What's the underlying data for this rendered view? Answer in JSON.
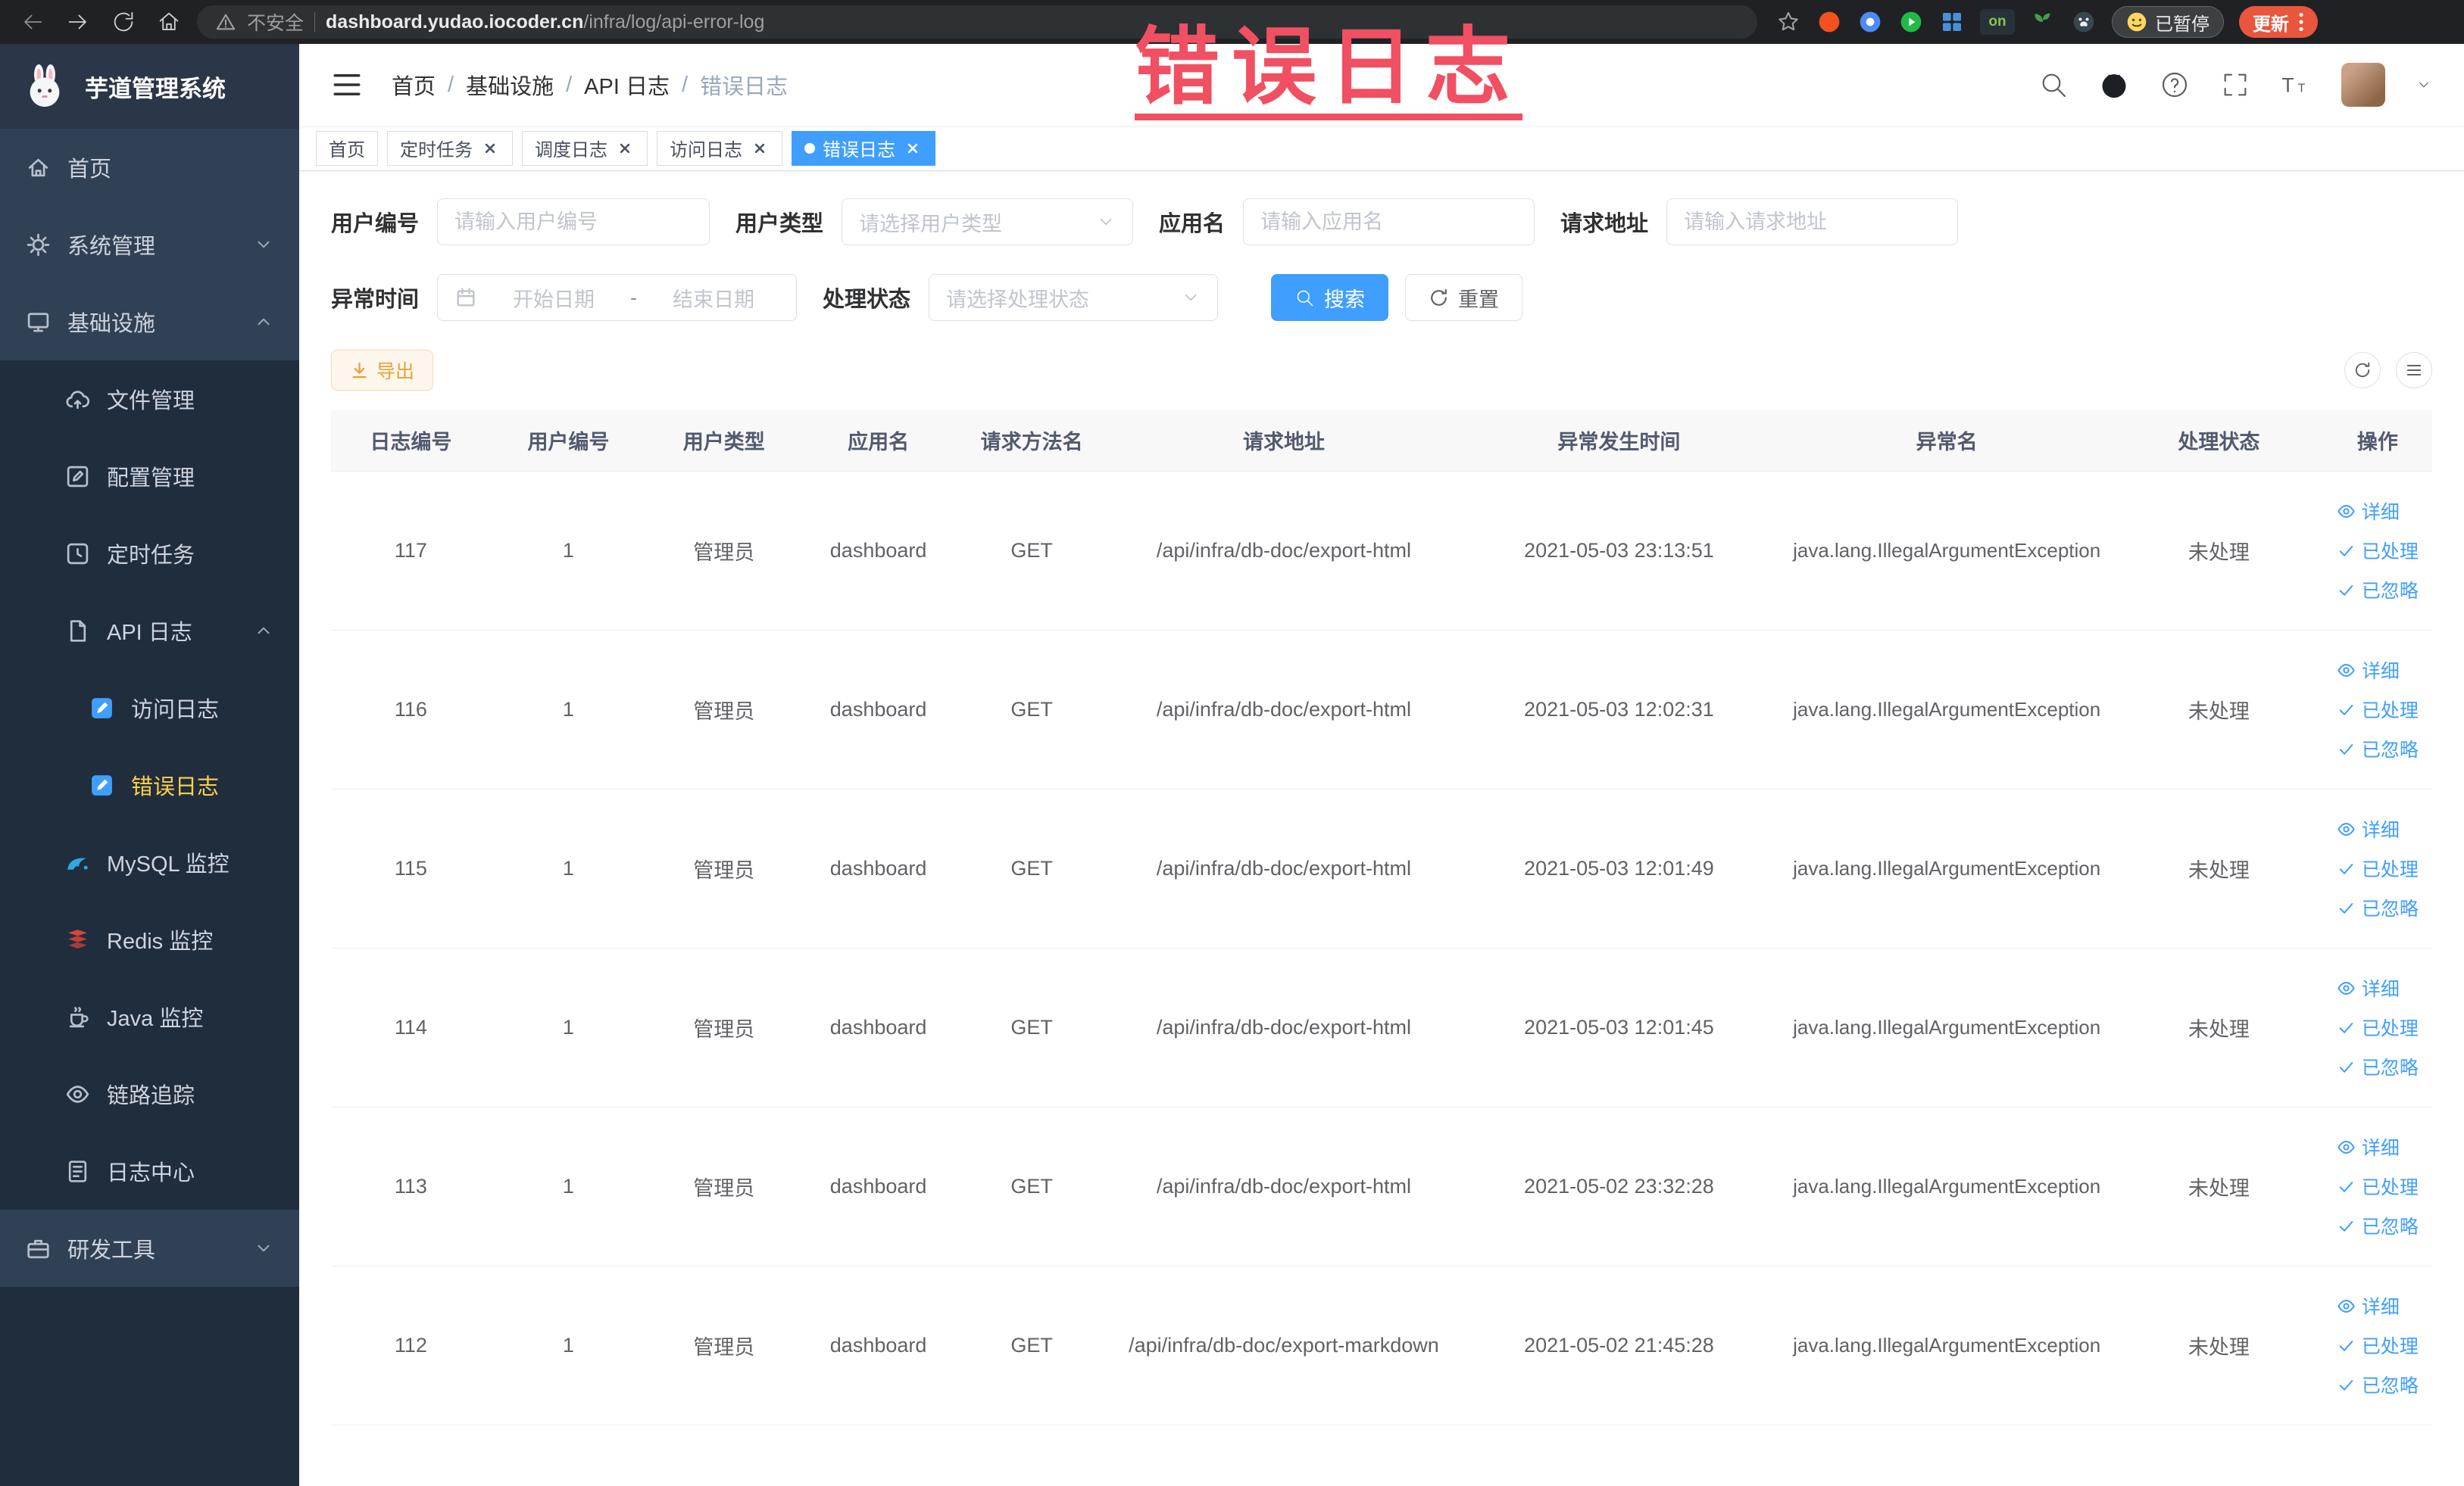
{
  "browser": {
    "security_label": "不安全",
    "url_domain": "dashboard.yudao.iocoder.cn",
    "url_path": "/infra/log/api-error-log",
    "extension_on_badge": "on",
    "paused_badge": "已暂停",
    "update_button": "更新"
  },
  "sidebar": {
    "app_title": "芋道管理系统",
    "items": [
      {
        "label": "首页"
      },
      {
        "label": "系统管理"
      },
      {
        "label": "基础设施"
      },
      {
        "label": "文件管理"
      },
      {
        "label": "配置管理"
      },
      {
        "label": "定时任务"
      },
      {
        "label": "API 日志"
      },
      {
        "label": "访问日志"
      },
      {
        "label": "错误日志"
      },
      {
        "label": "MySQL 监控"
      },
      {
        "label": "Redis 监控"
      },
      {
        "label": "Java 监控"
      },
      {
        "label": "链路追踪"
      },
      {
        "label": "日志中心"
      },
      {
        "label": "研发工具"
      }
    ]
  },
  "breadcrumb": {
    "separator": "/",
    "items": [
      "首页",
      "基础设施",
      "API 日志",
      "错误日志"
    ]
  },
  "tags": [
    {
      "label": "首页"
    },
    {
      "label": "定时任务"
    },
    {
      "label": "调度日志"
    },
    {
      "label": "访问日志"
    },
    {
      "label": "错误日志"
    }
  ],
  "filters": {
    "user_id": {
      "label": "用户编号",
      "placeholder": "请输入用户编号"
    },
    "user_type": {
      "label": "用户类型",
      "placeholder": "请选择用户类型"
    },
    "app_name": {
      "label": "应用名",
      "placeholder": "请输入应用名"
    },
    "request_url": {
      "label": "请求地址",
      "placeholder": "请输入请求地址"
    },
    "exception_time": {
      "label": "异常时间",
      "start_placeholder": "开始日期",
      "separator": "-",
      "end_placeholder": "结束日期"
    },
    "process_status": {
      "label": "处理状态",
      "placeholder": "请选择处理状态"
    },
    "search_button": "搜索",
    "reset_button": "重置"
  },
  "toolbar": {
    "export_button": "导出"
  },
  "table": {
    "columns": [
      "日志编号",
      "用户编号",
      "用户类型",
      "应用名",
      "请求方法名",
      "请求地址",
      "异常发生时间",
      "异常名",
      "处理状态",
      "操作"
    ],
    "actions": {
      "detail": "详细",
      "processed": "已处理",
      "ignored": "已忽略"
    },
    "rows": [
      {
        "id": "117",
        "user_id": "1",
        "user_type": "管理员",
        "app": "dashboard",
        "method": "GET",
        "url": "/api/infra/db-doc/export-html",
        "time": "2021-05-03 23:13:51",
        "exception": "java.lang.IllegalArgumentException",
        "status": "未处理"
      },
      {
        "id": "116",
        "user_id": "1",
        "user_type": "管理员",
        "app": "dashboard",
        "method": "GET",
        "url": "/api/infra/db-doc/export-html",
        "time": "2021-05-03 12:02:31",
        "exception": "java.lang.IllegalArgumentException",
        "status": "未处理"
      },
      {
        "id": "115",
        "user_id": "1",
        "user_type": "管理员",
        "app": "dashboard",
        "method": "GET",
        "url": "/api/infra/db-doc/export-html",
        "time": "2021-05-03 12:01:49",
        "exception": "java.lang.IllegalArgumentException",
        "status": "未处理"
      },
      {
        "id": "114",
        "user_id": "1",
        "user_type": "管理员",
        "app": "dashboard",
        "method": "GET",
        "url": "/api/infra/db-doc/export-html",
        "time": "2021-05-03 12:01:45",
        "exception": "java.lang.IllegalArgumentException",
        "status": "未处理"
      },
      {
        "id": "113",
        "user_id": "1",
        "user_type": "管理员",
        "app": "dashboard",
        "method": "GET",
        "url": "/api/infra/db-doc/export-html",
        "time": "2021-05-02 23:32:28",
        "exception": "java.lang.IllegalArgumentException",
        "status": "未处理"
      },
      {
        "id": "112",
        "user_id": "1",
        "user_type": "管理员",
        "app": "dashboard",
        "method": "GET",
        "url": "/api/infra/db-doc/export-markdown",
        "time": "2021-05-02 21:45:28",
        "exception": "java.lang.IllegalArgumentException",
        "status": "未处理"
      }
    ]
  },
  "overlay": {
    "annotation_text": "错误日志"
  }
}
